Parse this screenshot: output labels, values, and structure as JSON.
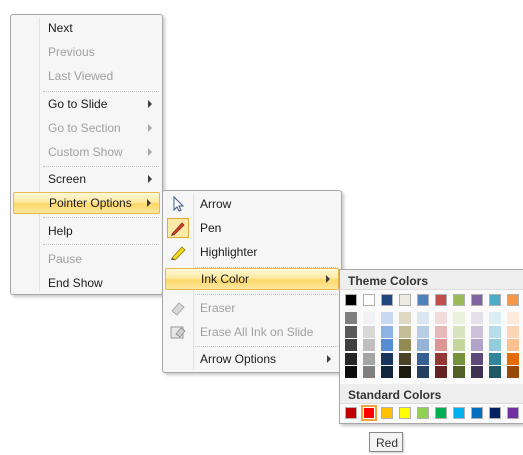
{
  "main_menu": {
    "items": [
      {
        "label": "Next",
        "enabled": true
      },
      {
        "label": "Previous",
        "enabled": false
      },
      {
        "label": "Last Viewed",
        "enabled": false
      },
      {
        "label": "Go to Slide",
        "enabled": true,
        "submenu": true
      },
      {
        "label": "Go to Section",
        "enabled": false,
        "submenu": true
      },
      {
        "label": "Custom Show",
        "enabled": false,
        "submenu": true
      },
      {
        "label": "Screen",
        "enabled": true,
        "submenu": true
      },
      {
        "label": "Pointer Options",
        "enabled": true,
        "submenu": true,
        "highlighted": true
      },
      {
        "label": "Help",
        "enabled": true
      },
      {
        "label": "Pause",
        "enabled": false
      },
      {
        "label": "End Show",
        "enabled": true
      }
    ]
  },
  "pointer_menu": {
    "items": [
      {
        "label": "Arrow",
        "icon": "arrow-pointer-icon",
        "enabled": true
      },
      {
        "label": "Pen",
        "icon": "pen-icon",
        "enabled": true,
        "checked": true
      },
      {
        "label": "Highlighter",
        "icon": "highlighter-icon",
        "enabled": true
      },
      {
        "label": "Ink Color",
        "enabled": true,
        "submenu": true,
        "highlighted": true
      },
      {
        "label": "Eraser",
        "icon": "eraser-icon",
        "enabled": false
      },
      {
        "label": "Erase All Ink on Slide",
        "icon": "erase-all-icon",
        "enabled": false
      },
      {
        "label": "Arrow Options",
        "enabled": true,
        "submenu": true
      }
    ]
  },
  "palette": {
    "theme_title": "Theme Colors",
    "standard_title": "Standard Colors",
    "theme_top": [
      "#000000",
      "#ffffff",
      "#1f497d",
      "#eeece1",
      "#4f81bd",
      "#c0504d",
      "#9bbb59",
      "#8064a2",
      "#4bacc6",
      "#f79646"
    ],
    "theme_shades": [
      [
        "#7f7f7f",
        "#f2f2f2",
        "#c6d9f0",
        "#ddd9c3",
        "#dbe5f1",
        "#f2dcdb",
        "#ebf1dd",
        "#e5e0ec",
        "#dbeef3",
        "#fdeada"
      ],
      [
        "#595959",
        "#d8d8d8",
        "#8db3e2",
        "#c4bd97",
        "#b8cce4",
        "#e5b9b7",
        "#d7e3bc",
        "#ccc1d9",
        "#b7dde8",
        "#fbd5b5"
      ],
      [
        "#3f3f3f",
        "#bfbfbf",
        "#548dd4",
        "#938953",
        "#95b3d7",
        "#d99694",
        "#c3d69b",
        "#b2a2c7",
        "#92cddc",
        "#fac08f"
      ],
      [
        "#262626",
        "#a5a5a5",
        "#17365d",
        "#494429",
        "#366092",
        "#953734",
        "#76923c",
        "#5f497a",
        "#31859b",
        "#e36c09"
      ],
      [
        "#0c0c0c",
        "#7f7f7f",
        "#0f243e",
        "#1d1b10",
        "#244061",
        "#632423",
        "#4f6128",
        "#3f3151",
        "#205867",
        "#974806"
      ]
    ],
    "standard": [
      "#c00000",
      "#ff0000",
      "#ffc000",
      "#ffff00",
      "#92d050",
      "#00b050",
      "#00b0f0",
      "#0070c0",
      "#002060",
      "#7030a0"
    ],
    "selected_standard_index": 1
  },
  "tooltip": {
    "text": "Red"
  }
}
